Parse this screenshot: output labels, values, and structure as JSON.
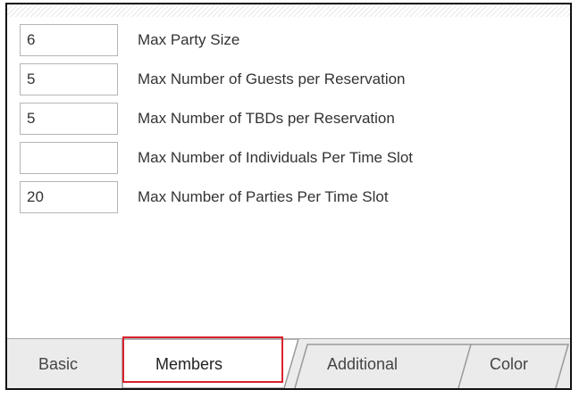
{
  "fields": [
    {
      "value": "6",
      "label": "Max Party Size"
    },
    {
      "value": "5",
      "label": "Max Number of Guests per Reservation"
    },
    {
      "value": "5",
      "label": "Max Number of TBDs per Reservation"
    },
    {
      "value": "",
      "label": "Max Number of Individuals Per Time Slot"
    },
    {
      "value": "20",
      "label": "Max Number of Parties Per Time Slot"
    }
  ],
  "tabs": [
    {
      "label": "Basic",
      "active": false
    },
    {
      "label": "Members",
      "active": true,
      "highlighted": true
    },
    {
      "label": "Additional",
      "active": false
    },
    {
      "label": "Color",
      "active": false
    }
  ],
  "colors": {
    "highlight": "#d9232f",
    "tab_bar_bg": "#ebebeb",
    "active_tab_bg": "#ffffff",
    "input_border": "#b5b5b5"
  }
}
